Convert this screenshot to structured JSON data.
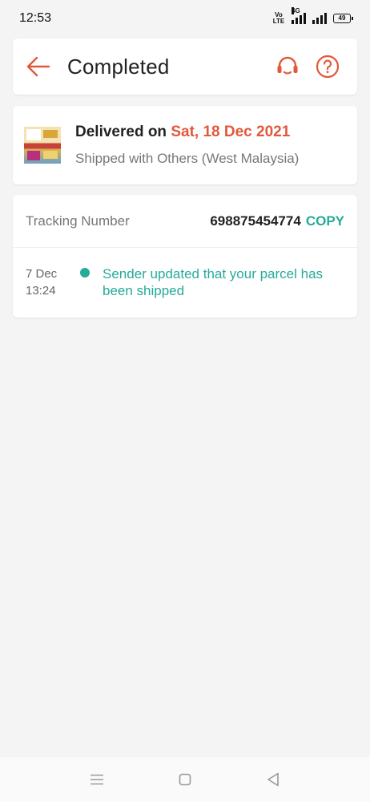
{
  "status_bar": {
    "time": "12:53",
    "volte_top": "Vo",
    "volte_bottom": "LTE",
    "network": "4G",
    "battery": "49"
  },
  "header": {
    "title": "Completed",
    "back_icon": "arrow-left-icon",
    "support_icon": "headset-icon",
    "help_icon": "question-circle-icon",
    "accent_color": "#e2583a"
  },
  "delivery": {
    "prefix": "Delivered on",
    "date": "Sat, 18 Dec 2021",
    "shipping": "Shipped with Others (West Malaysia)"
  },
  "tracking": {
    "label": "Tracking Number",
    "number": "698875454774",
    "copy_label": "COPY",
    "accent_color": "#26aa99",
    "events": [
      {
        "date": "7 Dec",
        "time": "13:24",
        "text": "Sender updated that your parcel has been shipped"
      }
    ]
  },
  "nav": {
    "menu_icon": "menu-icon",
    "home_icon": "home-square-icon",
    "back_icon": "back-triangle-icon"
  }
}
